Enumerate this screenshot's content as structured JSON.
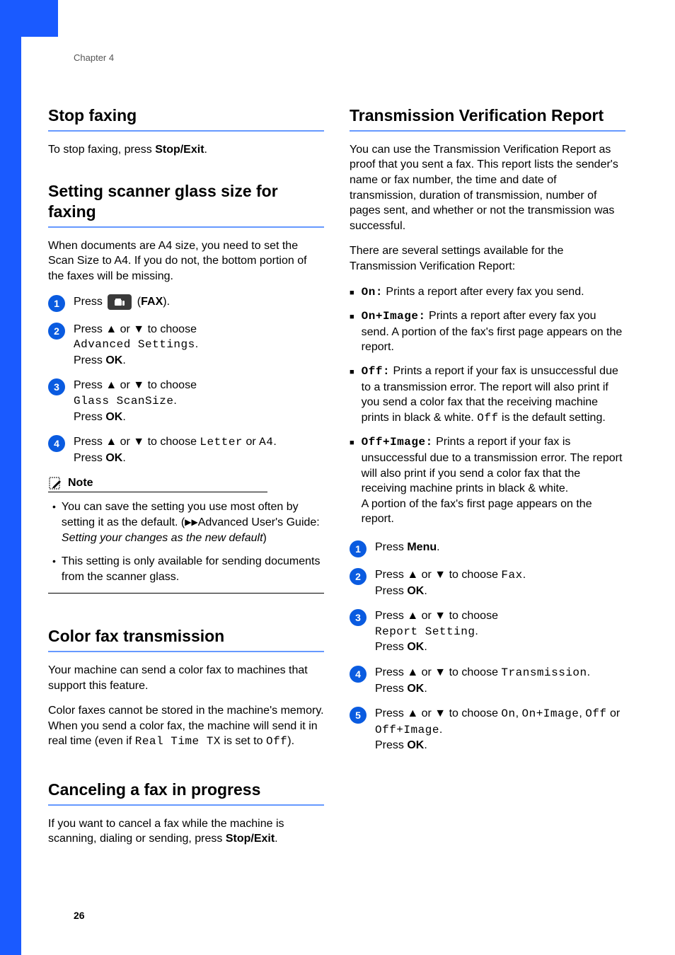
{
  "chapter": "Chapter 4",
  "pageNumber": "26",
  "left": {
    "stopFaxing": {
      "title": "Stop faxing",
      "body_prefix": "To stop faxing, press ",
      "body_bold": "Stop/Exit",
      "body_suffix": "."
    },
    "scannerGlass": {
      "title": "Setting scanner glass size for faxing",
      "intro": "When documents are A4 size, you need to set the Scan Size to A4. If you do not, the bottom portion of the faxes will be missing.",
      "step1_prefix": "Press ",
      "step1_fax": "FAX",
      "step1_suffix": ").",
      "step2_line1": "Press ▲ or ▼ to choose",
      "step2_mono": "Advanced Settings",
      "step2_period": ".",
      "step2_line3a": "Press ",
      "step2_ok": "OK",
      "step2_line3b": ".",
      "step3_line1": "Press ▲ or ▼ to choose",
      "step3_mono": "Glass ScanSize",
      "step3_period": ".",
      "step3_line3a": "Press ",
      "step3_ok": "OK",
      "step3_line3b": ".",
      "step4_line1a": "Press ▲ or ▼ to choose ",
      "step4_letter": "Letter",
      "step4_or": " or ",
      "step4_a4": "A4",
      "step4_line1b": ".",
      "step4_line2a": "Press ",
      "step4_ok": "OK",
      "step4_line2b": ".",
      "noteLabel": "Note",
      "note1_a": "You can save the setting you use most often by setting it as the default. (",
      "note1_arrows": "▶▶",
      "note1_b": "Advanced User's Guide: ",
      "note1_italic": "Setting your changes as the new default",
      "note1_c": ")",
      "note2": "This setting is only available for sending documents from the scanner glass."
    },
    "colorFax": {
      "title": "Color fax transmission",
      "p1": "Your machine can send a color fax to machines that support this feature.",
      "p2a": "Color faxes cannot be stored in the machine's memory. When you send a color fax, the machine will send it in real time (even if ",
      "p2_mono1": "Real Time TX",
      "p2b": " is set to ",
      "p2_mono2": "Off",
      "p2c": ")."
    },
    "canceling": {
      "title": "Canceling a fax in progress",
      "body_a": "If you want to cancel a fax while the machine is scanning, dialing or sending, press ",
      "body_bold": "Stop/Exit",
      "body_b": "."
    }
  },
  "right": {
    "tvr": {
      "title": "Transmission Verification Report",
      "intro": "You can use the Transmission Verification Report as proof that you sent a fax. This report lists the sender's name or fax number, the time and date of transmission, duration of transmission, number of pages sent, and whether or not the transmission was successful.",
      "settingsIntro": "There are several settings available for the Transmission Verification Report:",
      "on_label": "On:",
      "on_text": " Prints a report after every fax you send.",
      "onimg_label": "On+Image:",
      "onimg_text": " Prints a report after every fax you send. A portion of the fax's first page appears on the report.",
      "off_label": "Off:",
      "off_text_a": " Prints a report if your fax is unsuccessful due to a transmission error. The report will also print if you send a color fax that the receiving machine prints in black & white. ",
      "off_mono": "Off",
      "off_text_b": " is the default setting.",
      "offimg_label": "Off+Image:",
      "offimg_text": " Prints a report if your fax is unsuccessful due to a transmission error. The report will also print if you send a color fax that the receiving machine prints in black & white.",
      "offimg_text2": "A portion of the fax's first page appears on the report.",
      "step1_a": "Press ",
      "step1_menu": "Menu",
      "step1_b": ".",
      "step2_a": "Press ▲ or ▼ to choose ",
      "step2_mono": "Fax",
      "step2_b": ".",
      "step2_c": "Press ",
      "step2_ok": "OK",
      "step2_d": ".",
      "step3_a": "Press ▲ or ▼ to choose",
      "step3_mono": "Report Setting",
      "step3_b": ".",
      "step3_c": "Press ",
      "step3_ok": "OK",
      "step3_d": ".",
      "step4_a": "Press ▲ or ▼ to choose ",
      "step4_mono": "Transmission",
      "step4_b": ".",
      "step4_c": "Press ",
      "step4_ok": "OK",
      "step4_d": ".",
      "step5_a": "Press ▲ or ▼ to choose ",
      "step5_m1": "On",
      "step5_c1": ", ",
      "step5_m2": "On+Image",
      "step5_c2": ", ",
      "step5_m3": "Off",
      "step5_or": " or ",
      "step5_m4": "Off+Image",
      "step5_b": ".",
      "step5_c": "Press ",
      "step5_ok": "OK",
      "step5_d": "."
    }
  }
}
